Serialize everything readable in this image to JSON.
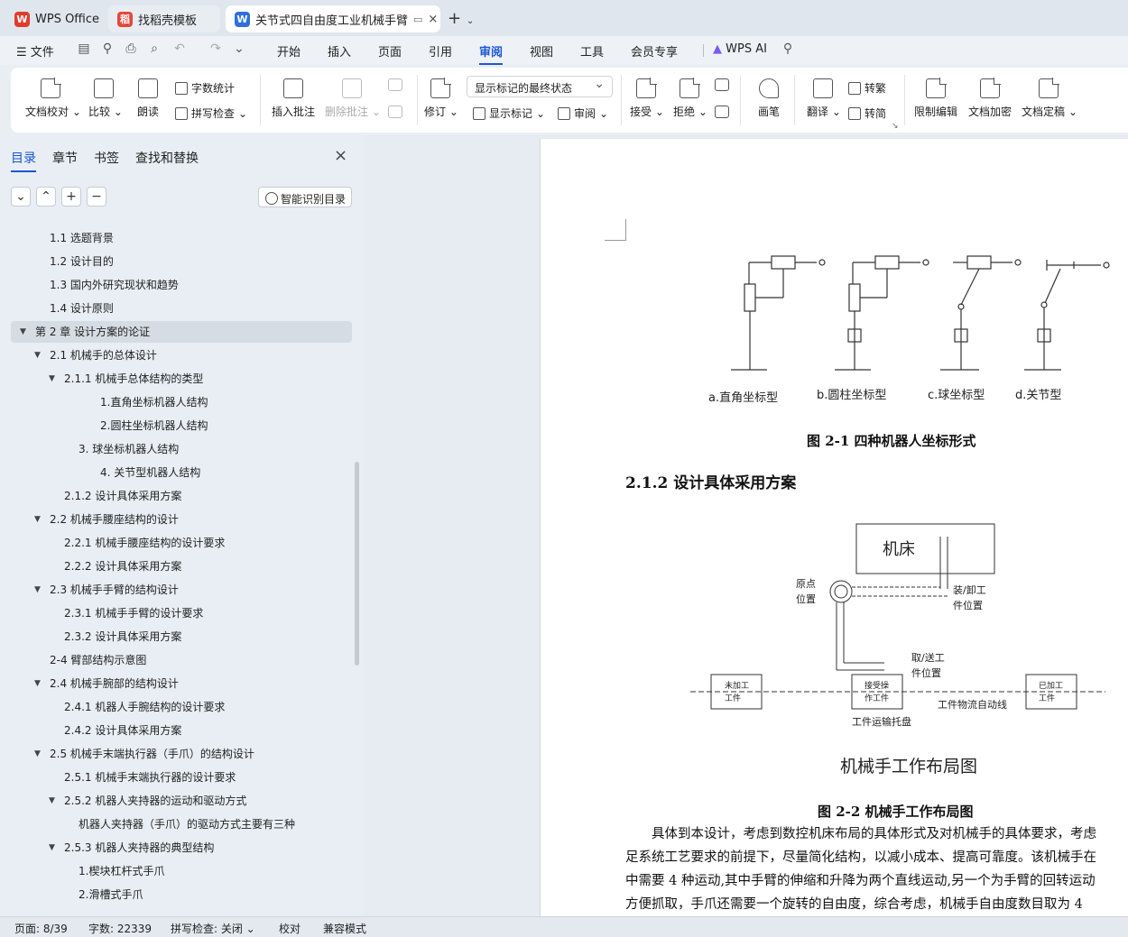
{
  "tabs": {
    "wps": "WPS Office",
    "template": "找稻壳模板",
    "doc": "关节式四自由度工业机械手臂",
    "colors": {
      "wps": "#e23b2e",
      "template": "#e6463a",
      "doc": "#2f6fe0"
    }
  },
  "menu": {
    "file": "文件",
    "items": [
      "开始",
      "插入",
      "页面",
      "引用",
      "审阅",
      "视图",
      "工具",
      "会员专享"
    ],
    "active": "审阅",
    "ai": "WPS AI"
  },
  "ribbon": {
    "proofread": "文档校对",
    "compare": "比较",
    "read": "朗读",
    "word_count": "字数统计",
    "spell_check": "拼写检查",
    "insert_comment": "插入批注",
    "delete_comment": "删除批注",
    "revise": "修订",
    "markup_state": "显示标记的最终状态",
    "show_markup": "显示标记",
    "review": "审阅",
    "accept": "接受",
    "reject": "拒绝",
    "pen": "画笔",
    "translate": "翻译",
    "to_traditional": "转繁",
    "to_simplified": "转简",
    "restrict_edit": "限制编辑",
    "encrypt": "文档加密",
    "finalize": "文档定稿"
  },
  "sidebar": {
    "tabs": [
      "目录",
      "章节",
      "书签",
      "查找和替换"
    ],
    "smart_toc": "智能识别目录",
    "toc": [
      {
        "text": "1.1  选题背景",
        "indent": 55,
        "arrow": false
      },
      {
        "text": "1.2  设计目的",
        "indent": 55,
        "arrow": false
      },
      {
        "text": "1.3  国内外研究现状和趋势",
        "indent": 55,
        "arrow": false
      },
      {
        "text": "1.4  设计原则",
        "indent": 55,
        "arrow": false
      },
      {
        "text": "第 2 章  设计方案的论证",
        "indent": 39,
        "arrow": true,
        "selected": true
      },
      {
        "text": "2.1 机械手的总体设计",
        "indent": 55,
        "arrow": true
      },
      {
        "text": "2.1.1  机械手总体结构的类型",
        "indent": 71,
        "arrow": true
      },
      {
        "text": "1.直角坐标机器人结构",
        "indent": 111,
        "arrow": false
      },
      {
        "text": "2.圆柱坐标机器人结构",
        "indent": 111,
        "arrow": false
      },
      {
        "text": "3.  球坐标机器人结构",
        "indent": 87,
        "arrow": false
      },
      {
        "text": "4.  关节型机器人结构",
        "indent": 111,
        "arrow": false
      },
      {
        "text": "2.1.2  设计具体采用方案",
        "indent": 71,
        "arrow": false
      },
      {
        "text": "2.2  机械手腰座结构的设计",
        "indent": 55,
        "arrow": true
      },
      {
        "text": "2.2.1  机械手腰座结构的设计要求",
        "indent": 71,
        "arrow": false
      },
      {
        "text": "2.2.2  设计具体采用方案",
        "indent": 71,
        "arrow": false
      },
      {
        "text": "2.3  机械手手臂的结构设计",
        "indent": 55,
        "arrow": true
      },
      {
        "text": "2.3.1  机械手手臂的设计要求",
        "indent": 71,
        "arrow": false
      },
      {
        "text": "2.3.2  设计具体采用方案",
        "indent": 71,
        "arrow": false
      },
      {
        "text": "2-4  臂部结构示意图",
        "indent": 55,
        "arrow": false
      },
      {
        "text": "2.4  机械手腕部的结构设计",
        "indent": 55,
        "arrow": true
      },
      {
        "text": "2.4.1  机器人手腕结构的设计要求",
        "indent": 71,
        "arrow": false
      },
      {
        "text": "2.4.2 设计具体采用方案",
        "indent": 71,
        "arrow": false
      },
      {
        "text": "2.5 机械手末端执行器（手爪）的结构设计",
        "indent": 55,
        "arrow": true
      },
      {
        "text": "2.5.1 机械手末端执行器的设计要求",
        "indent": 71,
        "arrow": false
      },
      {
        "text": "2.5.2 机器人夹持器的运动和驱动方式",
        "indent": 71,
        "arrow": true
      },
      {
        "text": "机器人夹持器（手爪）的驱动方式主要有三种",
        "indent": 87,
        "arrow": false
      },
      {
        "text": "2.5.3  机器人夹持器的典型结构",
        "indent": 71,
        "arrow": true
      },
      {
        "text": "1.楔块杠杆式手爪",
        "indent": 87,
        "arrow": false
      },
      {
        "text": "2.滑槽式手爪",
        "indent": 87,
        "arrow": false
      }
    ]
  },
  "document": {
    "fig1_labels": [
      "a.直角坐标型",
      "b.圆柱坐标型",
      "c.球坐标型",
      "d.关节型"
    ],
    "fig1_caption": "图 2-1    四种机器人坐标形式",
    "heading": "2.1.2  设计具体采用方案",
    "fig2": {
      "machine": "机床",
      "origin_1": "原点",
      "origin_2": "位置",
      "load_1": "装/卸工",
      "load_2": "件位置",
      "fetch_1": "取/送工",
      "fetch_2": "件位置",
      "unprocessed_1": "未加工",
      "unprocessed_2": "工件",
      "receive_1": "接受操",
      "receive_2": "作工件",
      "processed_1": "已加工",
      "processed_2": "工件",
      "line": "工件物流自动线",
      "tray": "工件运输托盘",
      "title": "机械手工作布局图"
    },
    "fig2_caption": "图 2-2  机械手工作布局图",
    "paragraph": [
      "　　具体到本设计，考虑到数控机床布局的具体形式及对机械手的具体要求，考虑",
      "足系统工艺要求的前提下，尽量简化结构，以减小成本、提高可靠度。该机械手在",
      "中需要 4 种运动,其中手臂的伸缩和升降为两个直线运动,另一个为手臂的回转运动",
      "方便抓取，手爪还需要一个旋转的自由度，综合考虑，机械手自由度数目取为 4"
    ]
  },
  "status": {
    "page": "页面: 8/39",
    "words": "字数: 22339",
    "spell": "拼写检查: 关闭",
    "proof": "校对",
    "compat": "兼容模式"
  }
}
